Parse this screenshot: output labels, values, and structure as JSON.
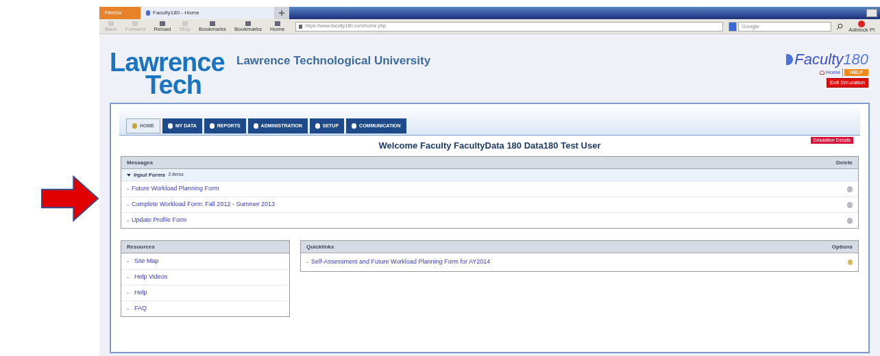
{
  "browser": {
    "app_button": "Firefox",
    "tab_title": "Faculty180 - Home",
    "toolbar": [
      {
        "label": "Back",
        "disabled": true
      },
      {
        "label": "Forward",
        "disabled": true
      },
      {
        "label": "Reload",
        "disabled": false
      },
      {
        "label": "Stop",
        "disabled": true
      },
      {
        "label": "Bookmarks",
        "disabled": false
      },
      {
        "label": "Bookmarks",
        "disabled": false
      },
      {
        "label": "Home",
        "disabled": false
      }
    ],
    "url": "https://www.faculty180.com/home.php",
    "search_placeholder": "Google",
    "addon": "Adblock Pl"
  },
  "header": {
    "logo_line_1": "Lawrence",
    "logo_line_2": "Tech",
    "title": "Lawrence Technological University",
    "brand": "Faculty",
    "brand_number": "180",
    "home_link": "Home",
    "help_button": "HELP",
    "exit_button": "Exit Emulation"
  },
  "tabs": [
    {
      "label": "HOME",
      "selected": true
    },
    {
      "label": "MY DATA",
      "selected": false
    },
    {
      "label": "REPORTS",
      "selected": false
    },
    {
      "label": "ADMINISTRATION",
      "selected": false
    },
    {
      "label": "SETUP",
      "selected": false
    },
    {
      "label": "COMMUNICATION",
      "selected": false
    }
  ],
  "welcome": "Welcome Faculty FacultyData 180 Data180 Test User",
  "emulation_details": "Emulation Details",
  "messages": {
    "title": "Messages",
    "action": "Delete",
    "group": {
      "label": "Input Forms",
      "count": "3 items",
      "expanded": true
    },
    "items": [
      "Future Workload Planning Form",
      "Complete Workload Form: Fall 2012 - Summer 2013",
      "Update Profile Form"
    ]
  },
  "resources": {
    "title": "Resources",
    "items": [
      "Site Map",
      "Help Videos",
      "Help",
      "FAQ"
    ]
  },
  "quicklinks": {
    "title": "Quicklinks",
    "action": "Options",
    "items": [
      "Self-Assessment and Future Workload Planning Form for AY2014"
    ]
  }
}
